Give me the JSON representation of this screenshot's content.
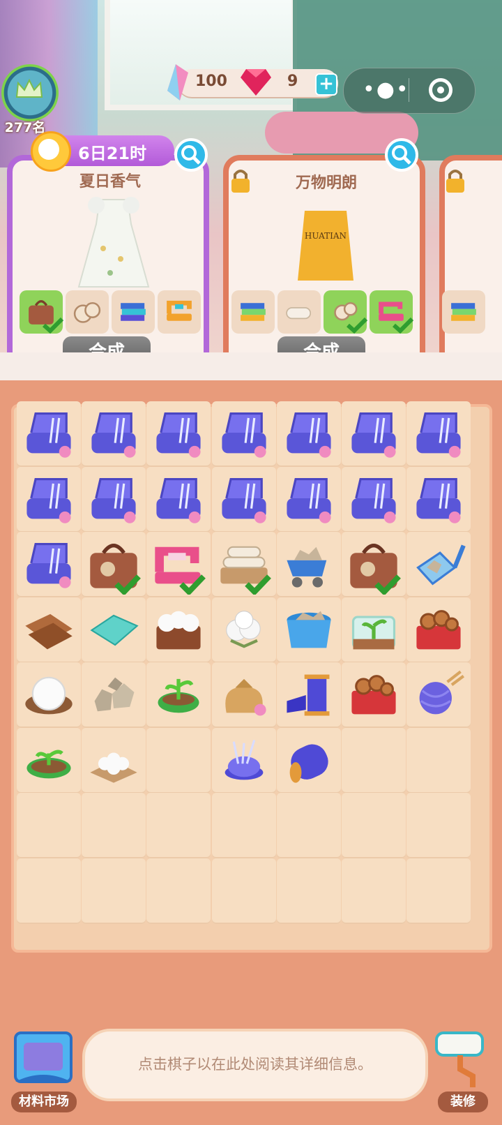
{
  "hud": {
    "rank": "277名",
    "energy": "100",
    "gems": "9",
    "plus_label": "+"
  },
  "orders": [
    {
      "timer": "6日21时",
      "title": "夏日香气",
      "merge_label": "合成",
      "items": [
        {
          "icon": "leather-bag-icon",
          "done": true
        },
        {
          "icon": "towel-roll-icon",
          "done": false
        },
        {
          "icon": "folded-fabric-icon",
          "done": false
        },
        {
          "icon": "sewing-machine-icon",
          "done": false
        }
      ]
    },
    {
      "title": "万物明朗",
      "merge_label": "合成",
      "locked": true,
      "items": [
        {
          "icon": "folded-fabric-icon",
          "done": false
        },
        {
          "icon": "towel-roll-icon",
          "done": false
        },
        {
          "icon": "towel-roll-icon",
          "done": true
        },
        {
          "icon": "sewing-machine-icon",
          "done": true
        }
      ]
    },
    {
      "locked": true,
      "items": [
        {
          "icon": "folded-fabric-icon",
          "done": false
        }
      ]
    }
  ],
  "board": {
    "rows": [
      [
        "sewing-box-icon",
        "sewing-box-icon",
        "sewing-box-icon",
        "sewing-box-icon",
        "sewing-box-icon",
        "sewing-box-icon",
        "sewing-box-icon"
      ],
      [
        "sewing-box-icon",
        "sewing-box-icon",
        "sewing-box-icon",
        "sewing-box-icon",
        "sewing-box-icon",
        "sewing-box-icon",
        "sewing-box-icon"
      ],
      [
        "sewing-box-icon",
        "leather-bag-icon",
        "sewing-machine-icon",
        "towel-tray-icon",
        "stone-cart-icon",
        "leather-bag-icon",
        "stone-scoop-icon"
      ],
      [
        "wood-planks-icon",
        "fabric-cloth-icon",
        "cotton-crate-icon",
        "cotton-ball-icon",
        "stone-bucket-icon",
        "sprout-terrarium-icon",
        "wood-chest-icon"
      ],
      [
        "cotton-basket-icon",
        "stones-icon",
        "sprout-pot-icon",
        "seed-bag-icon",
        "thread-spool-icon",
        "wood-chest-icon",
        "yarn-ball-icon"
      ],
      [
        "sprout-dish-icon",
        "cotton-pile-icon",
        "",
        "pincushion-icon",
        "fabric-roll-icon",
        "",
        ""
      ],
      [
        "",
        "",
        "",
        "",
        "",
        "",
        ""
      ],
      [
        "",
        "",
        "",
        "",
        "",
        "",
        ""
      ]
    ],
    "checked": [
      [
        2,
        1
      ],
      [
        2,
        2
      ],
      [
        2,
        3
      ],
      [
        2,
        5
      ]
    ]
  },
  "info": {
    "text": "点击棋子以在此处阅读其详细信息。"
  },
  "bottom": {
    "market_label": "材料市场",
    "decor_label": "装修"
  },
  "colors": {
    "order_active": "#b268d9",
    "order_locked": "#e07b5d",
    "merge_button": "#6e6e6e",
    "accent_blue": "#2fb9e8"
  }
}
